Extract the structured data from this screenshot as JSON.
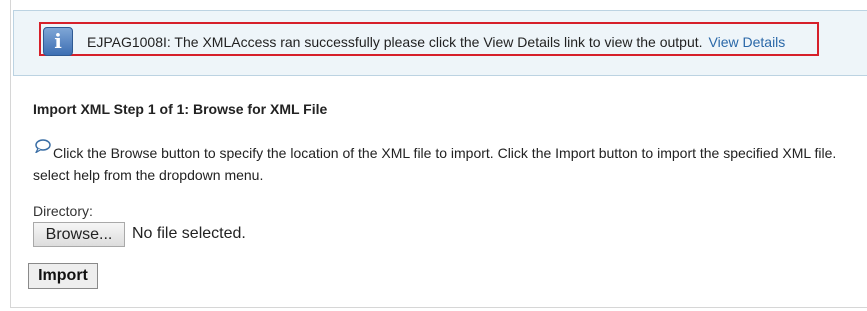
{
  "message": {
    "text": "EJPAG1008I: The XMLAccess ran successfully please click the View Details link to view the output.",
    "link_label": "View Details",
    "icon": "info-icon",
    "highlight_color": "#d6202a"
  },
  "step": {
    "title": "Import XML Step 1 of 1: Browse for XML File"
  },
  "help": {
    "icon": "speech-bubble-icon",
    "line1": "Click the Browse button to specify the location of the XML file to import. Click the Import button to import the specified XML file.",
    "line2": "select help from the dropdown menu."
  },
  "form": {
    "directory_label": "Directory:",
    "browse_label": "Browse...",
    "file_status": "No file selected.",
    "import_label": "Import"
  }
}
